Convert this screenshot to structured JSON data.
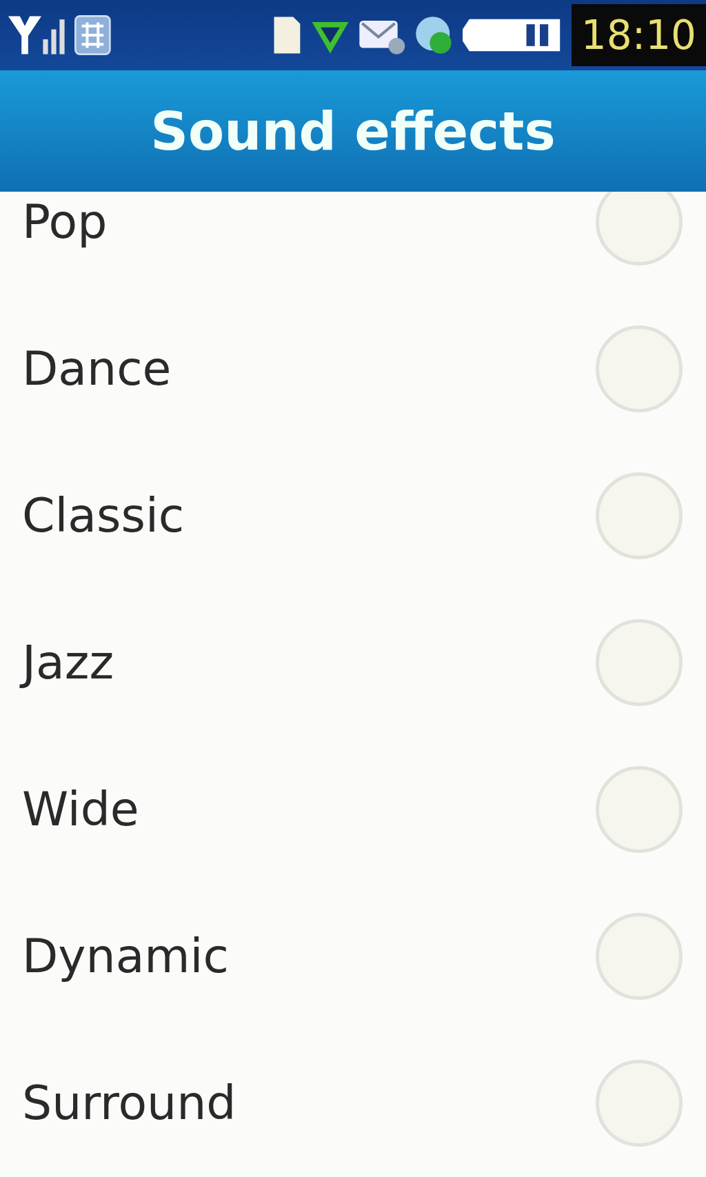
{
  "status_bar": {
    "time": "18:10"
  },
  "title": "Sound effects",
  "options": [
    {
      "label": "Pop",
      "selected": false
    },
    {
      "label": "Dance",
      "selected": false
    },
    {
      "label": "Classic",
      "selected": false
    },
    {
      "label": "Jazz",
      "selected": false
    },
    {
      "label": "Wide",
      "selected": false
    },
    {
      "label": "Dynamic",
      "selected": false
    },
    {
      "label": "Surround",
      "selected": false
    }
  ]
}
